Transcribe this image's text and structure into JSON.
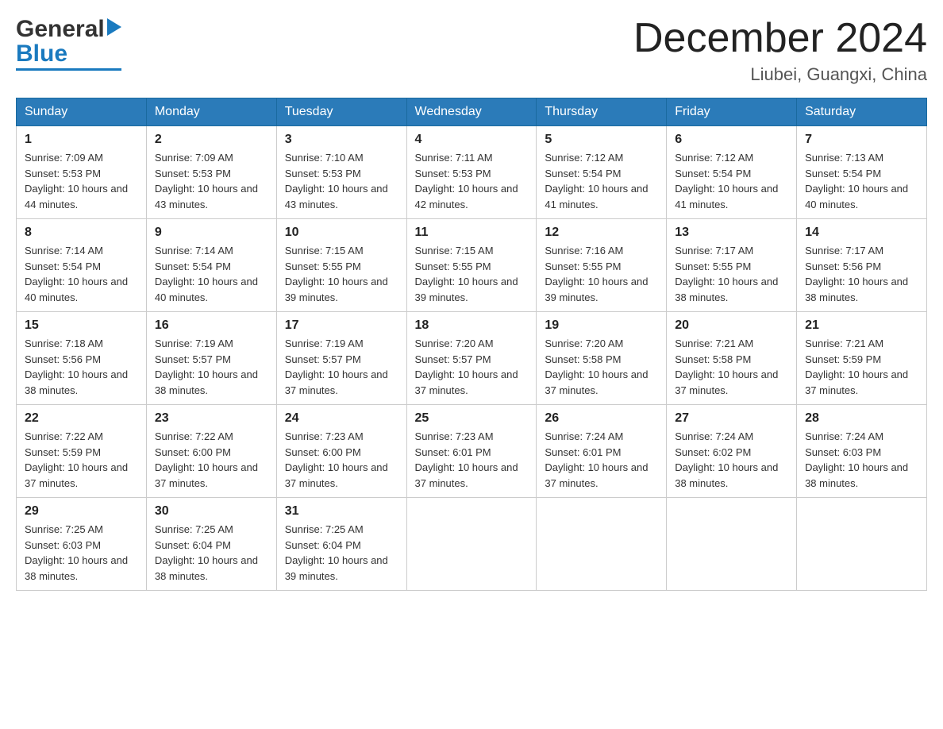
{
  "header": {
    "logo_general": "General",
    "logo_blue": "Blue",
    "month_title": "December 2024",
    "subtitle": "Liubei, Guangxi, China"
  },
  "days_of_week": [
    "Sunday",
    "Monday",
    "Tuesday",
    "Wednesday",
    "Thursday",
    "Friday",
    "Saturday"
  ],
  "weeks": [
    [
      {
        "day": "1",
        "sunrise": "7:09 AM",
        "sunset": "5:53 PM",
        "daylight": "10 hours and 44 minutes."
      },
      {
        "day": "2",
        "sunrise": "7:09 AM",
        "sunset": "5:53 PM",
        "daylight": "10 hours and 43 minutes."
      },
      {
        "day": "3",
        "sunrise": "7:10 AM",
        "sunset": "5:53 PM",
        "daylight": "10 hours and 43 minutes."
      },
      {
        "day": "4",
        "sunrise": "7:11 AM",
        "sunset": "5:53 PM",
        "daylight": "10 hours and 42 minutes."
      },
      {
        "day": "5",
        "sunrise": "7:12 AM",
        "sunset": "5:54 PM",
        "daylight": "10 hours and 41 minutes."
      },
      {
        "day": "6",
        "sunrise": "7:12 AM",
        "sunset": "5:54 PM",
        "daylight": "10 hours and 41 minutes."
      },
      {
        "day": "7",
        "sunrise": "7:13 AM",
        "sunset": "5:54 PM",
        "daylight": "10 hours and 40 minutes."
      }
    ],
    [
      {
        "day": "8",
        "sunrise": "7:14 AM",
        "sunset": "5:54 PM",
        "daylight": "10 hours and 40 minutes."
      },
      {
        "day": "9",
        "sunrise": "7:14 AM",
        "sunset": "5:54 PM",
        "daylight": "10 hours and 40 minutes."
      },
      {
        "day": "10",
        "sunrise": "7:15 AM",
        "sunset": "5:55 PM",
        "daylight": "10 hours and 39 minutes."
      },
      {
        "day": "11",
        "sunrise": "7:15 AM",
        "sunset": "5:55 PM",
        "daylight": "10 hours and 39 minutes."
      },
      {
        "day": "12",
        "sunrise": "7:16 AM",
        "sunset": "5:55 PM",
        "daylight": "10 hours and 39 minutes."
      },
      {
        "day": "13",
        "sunrise": "7:17 AM",
        "sunset": "5:55 PM",
        "daylight": "10 hours and 38 minutes."
      },
      {
        "day": "14",
        "sunrise": "7:17 AM",
        "sunset": "5:56 PM",
        "daylight": "10 hours and 38 minutes."
      }
    ],
    [
      {
        "day": "15",
        "sunrise": "7:18 AM",
        "sunset": "5:56 PM",
        "daylight": "10 hours and 38 minutes."
      },
      {
        "day": "16",
        "sunrise": "7:19 AM",
        "sunset": "5:57 PM",
        "daylight": "10 hours and 38 minutes."
      },
      {
        "day": "17",
        "sunrise": "7:19 AM",
        "sunset": "5:57 PM",
        "daylight": "10 hours and 37 minutes."
      },
      {
        "day": "18",
        "sunrise": "7:20 AM",
        "sunset": "5:57 PM",
        "daylight": "10 hours and 37 minutes."
      },
      {
        "day": "19",
        "sunrise": "7:20 AM",
        "sunset": "5:58 PM",
        "daylight": "10 hours and 37 minutes."
      },
      {
        "day": "20",
        "sunrise": "7:21 AM",
        "sunset": "5:58 PM",
        "daylight": "10 hours and 37 minutes."
      },
      {
        "day": "21",
        "sunrise": "7:21 AM",
        "sunset": "5:59 PM",
        "daylight": "10 hours and 37 minutes."
      }
    ],
    [
      {
        "day": "22",
        "sunrise": "7:22 AM",
        "sunset": "5:59 PM",
        "daylight": "10 hours and 37 minutes."
      },
      {
        "day": "23",
        "sunrise": "7:22 AM",
        "sunset": "6:00 PM",
        "daylight": "10 hours and 37 minutes."
      },
      {
        "day": "24",
        "sunrise": "7:23 AM",
        "sunset": "6:00 PM",
        "daylight": "10 hours and 37 minutes."
      },
      {
        "day": "25",
        "sunrise": "7:23 AM",
        "sunset": "6:01 PM",
        "daylight": "10 hours and 37 minutes."
      },
      {
        "day": "26",
        "sunrise": "7:24 AM",
        "sunset": "6:01 PM",
        "daylight": "10 hours and 37 minutes."
      },
      {
        "day": "27",
        "sunrise": "7:24 AM",
        "sunset": "6:02 PM",
        "daylight": "10 hours and 38 minutes."
      },
      {
        "day": "28",
        "sunrise": "7:24 AM",
        "sunset": "6:03 PM",
        "daylight": "10 hours and 38 minutes."
      }
    ],
    [
      {
        "day": "29",
        "sunrise": "7:25 AM",
        "sunset": "6:03 PM",
        "daylight": "10 hours and 38 minutes."
      },
      {
        "day": "30",
        "sunrise": "7:25 AM",
        "sunset": "6:04 PM",
        "daylight": "10 hours and 38 minutes."
      },
      {
        "day": "31",
        "sunrise": "7:25 AM",
        "sunset": "6:04 PM",
        "daylight": "10 hours and 39 minutes."
      },
      null,
      null,
      null,
      null
    ]
  ],
  "labels": {
    "sunrise_prefix": "Sunrise: ",
    "sunset_prefix": "Sunset: ",
    "daylight_prefix": "Daylight: "
  }
}
